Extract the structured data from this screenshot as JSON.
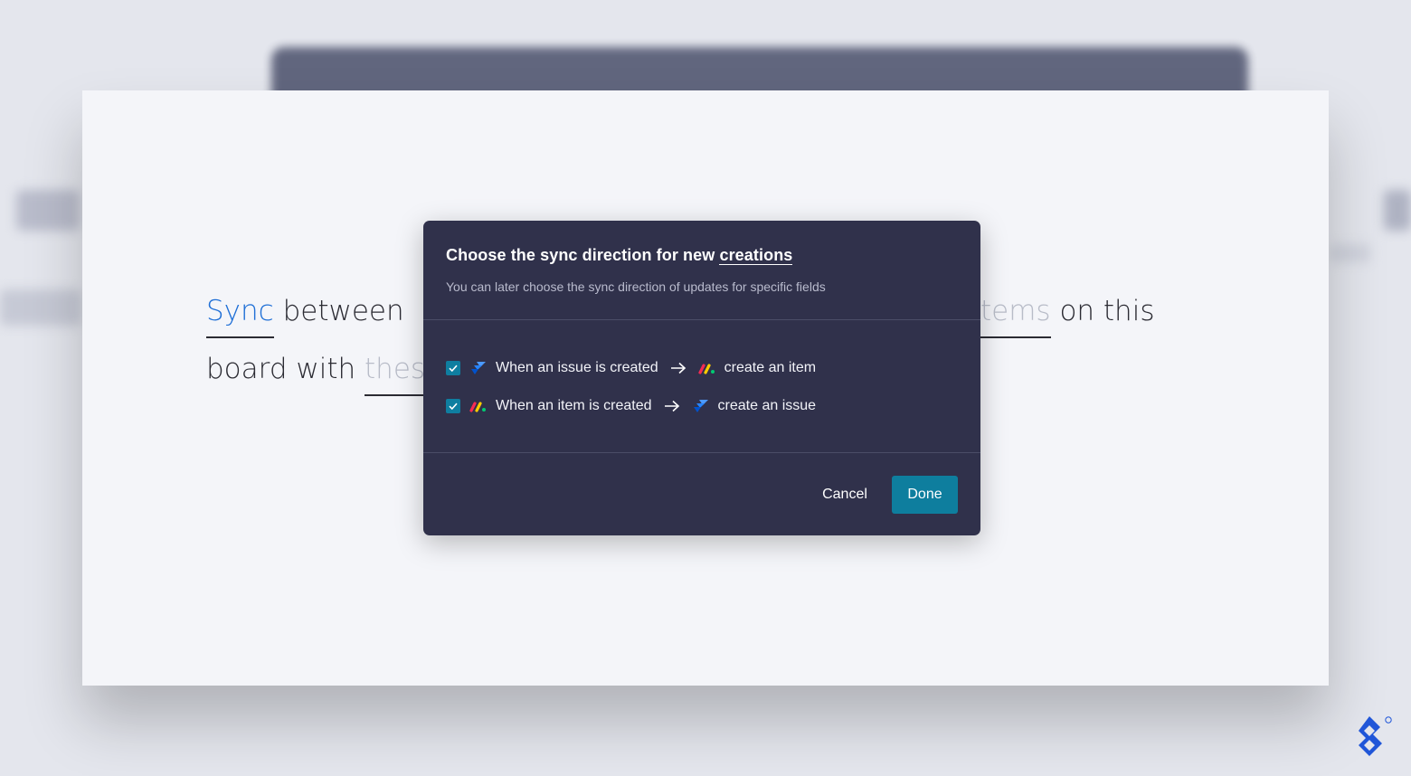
{
  "background": {
    "sentence_line1_start": [
      "Sync",
      "between"
    ],
    "sentence_line1_end": [
      "tems",
      "on this"
    ],
    "sentence_line2": [
      "board with",
      "thes"
    ]
  },
  "modal": {
    "title_prefix": "Choose the sync direction for new",
    "title_emphasis": "creations",
    "subtitle": "You can later choose the sync direction of updates for specific fields",
    "options": [
      {
        "checked": true,
        "source_icon": "jira-icon",
        "source_text": "When an issue is created",
        "target_icon": "monday-icon",
        "target_text": "create an item"
      },
      {
        "checked": true,
        "source_icon": "monday-icon",
        "source_text": "When an item is created",
        "target_icon": "jira-icon",
        "target_text": "create an issue"
      }
    ],
    "cancel_label": "Cancel",
    "done_label": "Done"
  },
  "colors": {
    "accent_text": "#1f6fd6",
    "modal_bg": "#30314b",
    "checkbox": "#0f7ea0",
    "done_button": "#0e7e9e"
  }
}
